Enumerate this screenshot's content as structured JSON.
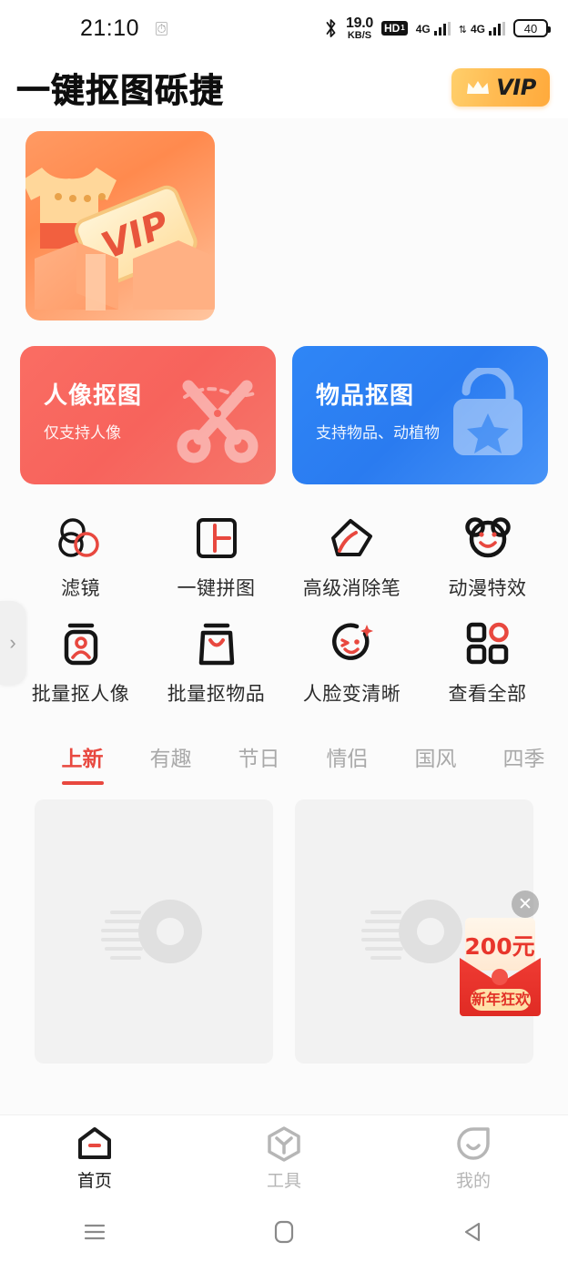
{
  "status_bar": {
    "time": "21:10",
    "alarm_icon": "alarm-icon",
    "bluetooth_icon": "bluetooth-icon",
    "network_speed": "19.0",
    "network_speed_unit": "KB/S",
    "hd_label": "HD",
    "hd_sub": "1",
    "sim1_label": "4G",
    "sim2_label": "4G",
    "battery_level": "40"
  },
  "header": {
    "title": "一键抠图砾捷",
    "vip_label": "VIP",
    "crown_icon": "crown-icon"
  },
  "banner": {
    "name": "vip-promo-banner",
    "text": "VIP"
  },
  "main_cards": [
    {
      "title": "人像抠图",
      "subtitle": "仅支持人像",
      "icon": "scissors-icon",
      "color": "#f7635c"
    },
    {
      "title": "物品抠图",
      "subtitle": "支持物品、动植物",
      "icon": "shopping-bag-star-icon",
      "color": "#2a7bf0"
    }
  ],
  "features": [
    {
      "label": "滤镜",
      "icon": "filter-circles-icon"
    },
    {
      "label": "一键拼图",
      "icon": "collage-grid-icon"
    },
    {
      "label": "高级消除笔",
      "icon": "eraser-icon"
    },
    {
      "label": "动漫特效",
      "icon": "bear-face-icon"
    },
    {
      "label": "批量抠人像",
      "icon": "batch-portrait-icon"
    },
    {
      "label": "批量抠物品",
      "icon": "batch-object-icon"
    },
    {
      "label": "人脸变清晰",
      "icon": "face-enhance-icon"
    },
    {
      "label": "查看全部",
      "icon": "grid-all-icon"
    }
  ],
  "tabs": [
    {
      "label": "上新",
      "active": true
    },
    {
      "label": "有趣",
      "active": false
    },
    {
      "label": "节日",
      "active": false
    },
    {
      "label": "情侣",
      "active": false
    },
    {
      "label": "国风",
      "active": false
    },
    {
      "label": "四季",
      "active": false
    }
  ],
  "template_cards": [
    {
      "name": "template-card-1",
      "placeholder_icon": "image-placeholder-icon"
    },
    {
      "name": "template-card-2",
      "placeholder_icon": "image-placeholder-icon"
    }
  ],
  "drawer_handle": {
    "icon": "chevron-right-icon",
    "glyph": "›"
  },
  "promo": {
    "amount": "200元",
    "badge": "新年狂欢",
    "close_icon": "close-icon",
    "close_glyph": "✕"
  },
  "bottom_nav": [
    {
      "label": "首页",
      "icon": "home-icon",
      "active": true
    },
    {
      "label": "工具",
      "icon": "tools-hexagon-icon",
      "active": false
    },
    {
      "label": "我的",
      "icon": "profile-face-icon",
      "active": false
    }
  ],
  "system_nav": [
    {
      "name": "recents-button",
      "icon": "menu-lines-icon"
    },
    {
      "name": "home-button",
      "icon": "rounded-square-icon"
    },
    {
      "name": "back-button",
      "icon": "triangle-left-icon"
    }
  ],
  "colors": {
    "accent_red": "#e8483f",
    "card_red": "#f7635c",
    "card_blue": "#2a7bf0",
    "vip_gold": "#ffbb52",
    "background": "#fbfbfb"
  }
}
